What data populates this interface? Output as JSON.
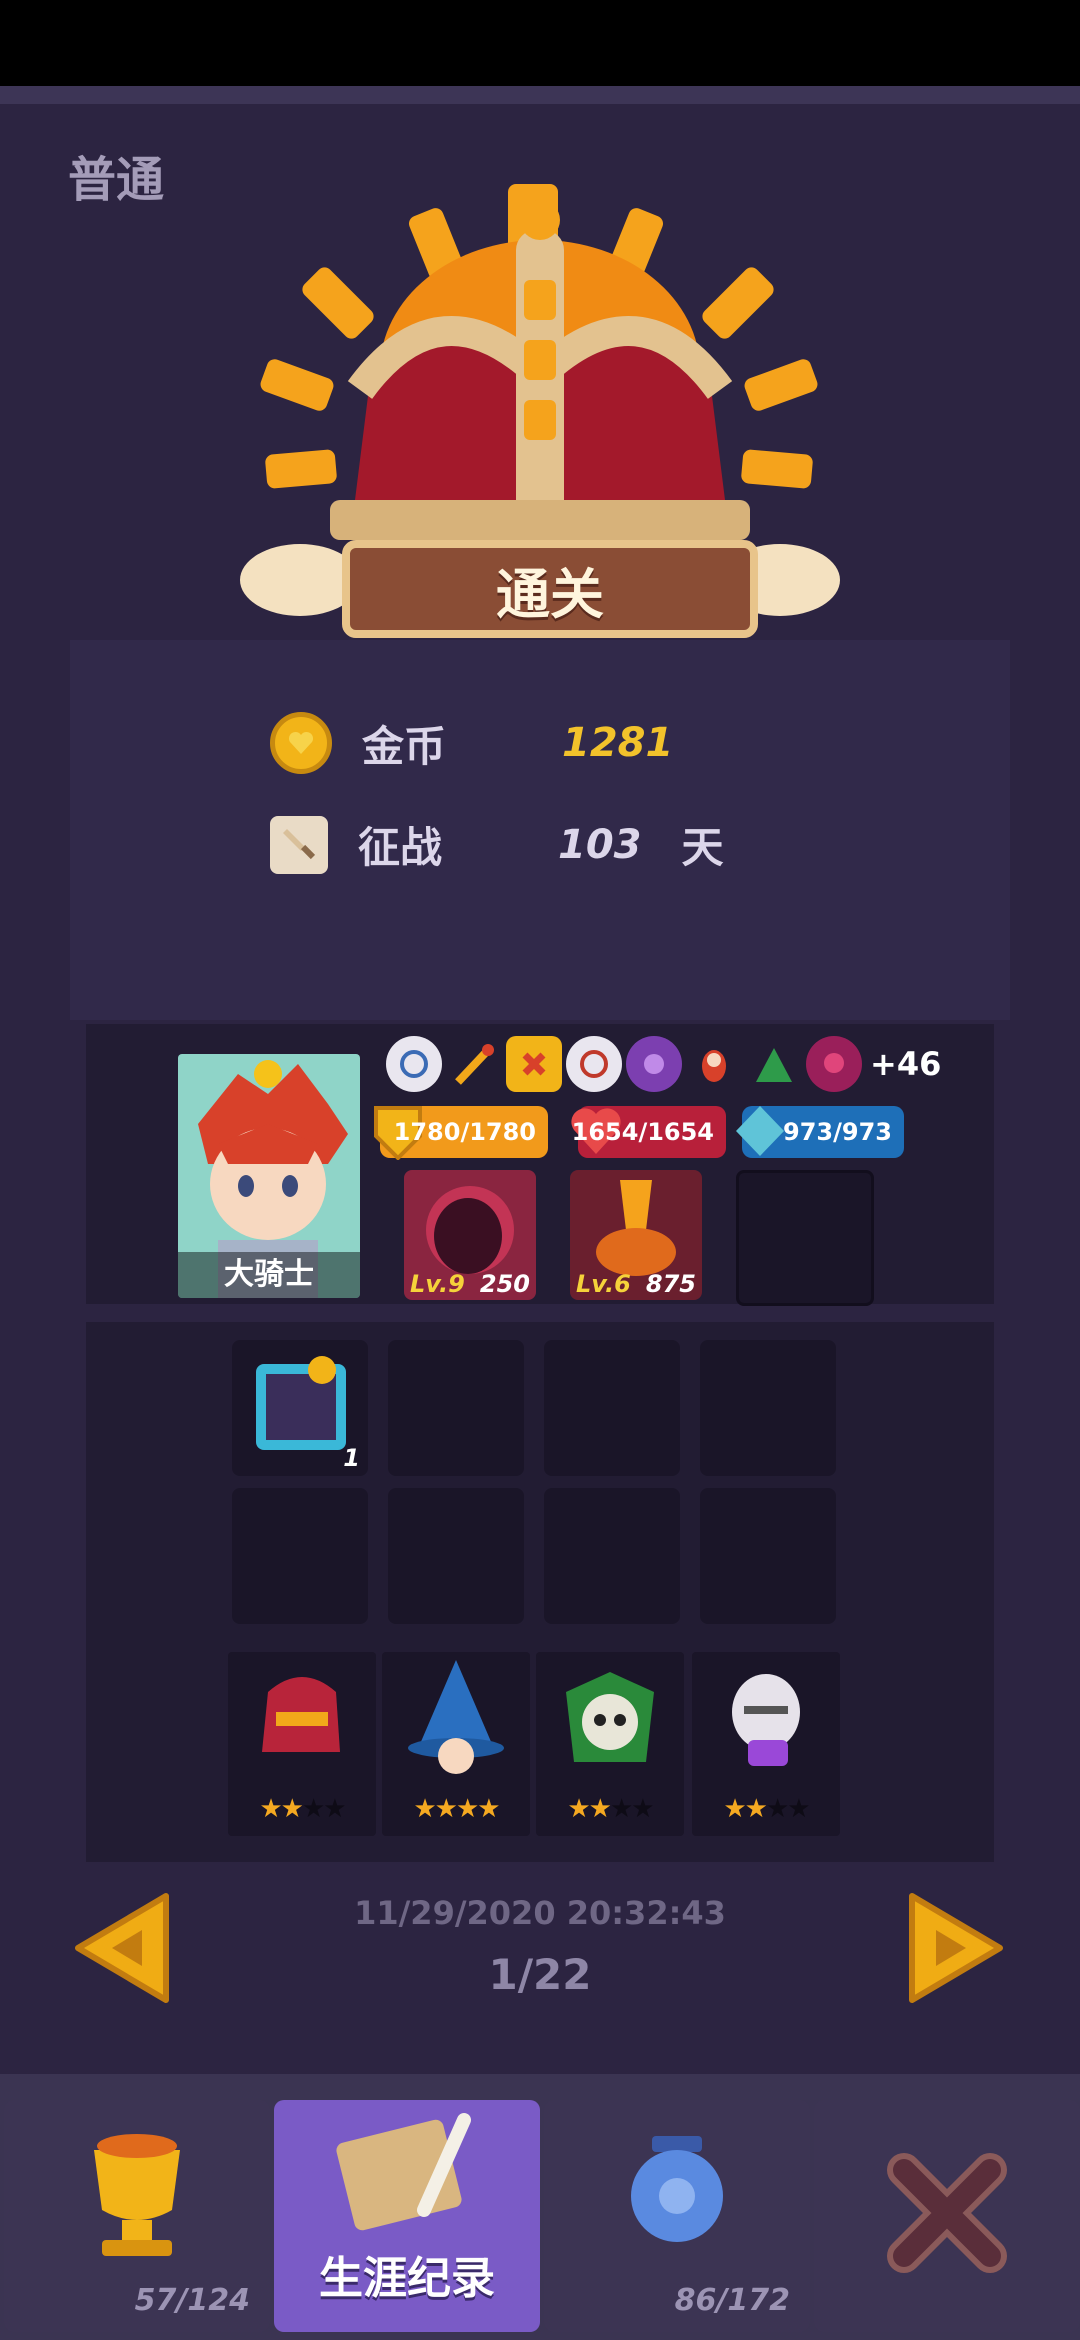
{
  "header": {
    "difficulty": "普通"
  },
  "result": {
    "banner": "通关"
  },
  "stats": {
    "gold_label": "金币",
    "gold_value": "1281",
    "gold_color": "#f2c22b",
    "days_label": "征战",
    "days_value": "103",
    "days_unit": "天"
  },
  "hero": {
    "name": "大骑士",
    "relics": [
      "compass-relic",
      "golden-staff-relic",
      "red-x-shield-relic",
      "compass-relic-2",
      "purple-gear-relic",
      "winged-doll-relic",
      "green-tent-relic",
      "skull-relic"
    ],
    "more_relics": "+46",
    "armor": "1780/1780",
    "health": "1654/1654",
    "mana": "973/973",
    "skills": [
      {
        "icon": "shadow-creature-icon",
        "level": "Lv.9",
        "value": "250"
      },
      {
        "icon": "fire-pipe-icon",
        "level": "Lv.6",
        "value": "875"
      }
    ]
  },
  "inventory": {
    "items": [
      {
        "icon": "treasure-chest-card-icon",
        "count": "1"
      }
    ]
  },
  "companions": [
    {
      "icon": "red-helmet-knight-icon",
      "stars_on": 2,
      "stars_total": 4
    },
    {
      "icon": "blue-wizard-icon",
      "stars_on": 4,
      "stars_total": 4
    },
    {
      "icon": "green-skull-reaper-icon",
      "stars_on": 2,
      "stars_total": 4
    },
    {
      "icon": "white-helmet-alchemist-icon",
      "stars_on": 2,
      "stars_total": 4
    }
  ],
  "record": {
    "timestamp": "11/29/2020 20:32:43",
    "page": "1/22"
  },
  "tabs": [
    {
      "icon": "trophy-icon",
      "count": "57/124"
    },
    {
      "icon": "scroll-quill-icon",
      "label": "生涯纪录"
    },
    {
      "icon": "blue-vase-icon",
      "count": "86/172"
    },
    {
      "icon": "close-icon"
    }
  ]
}
